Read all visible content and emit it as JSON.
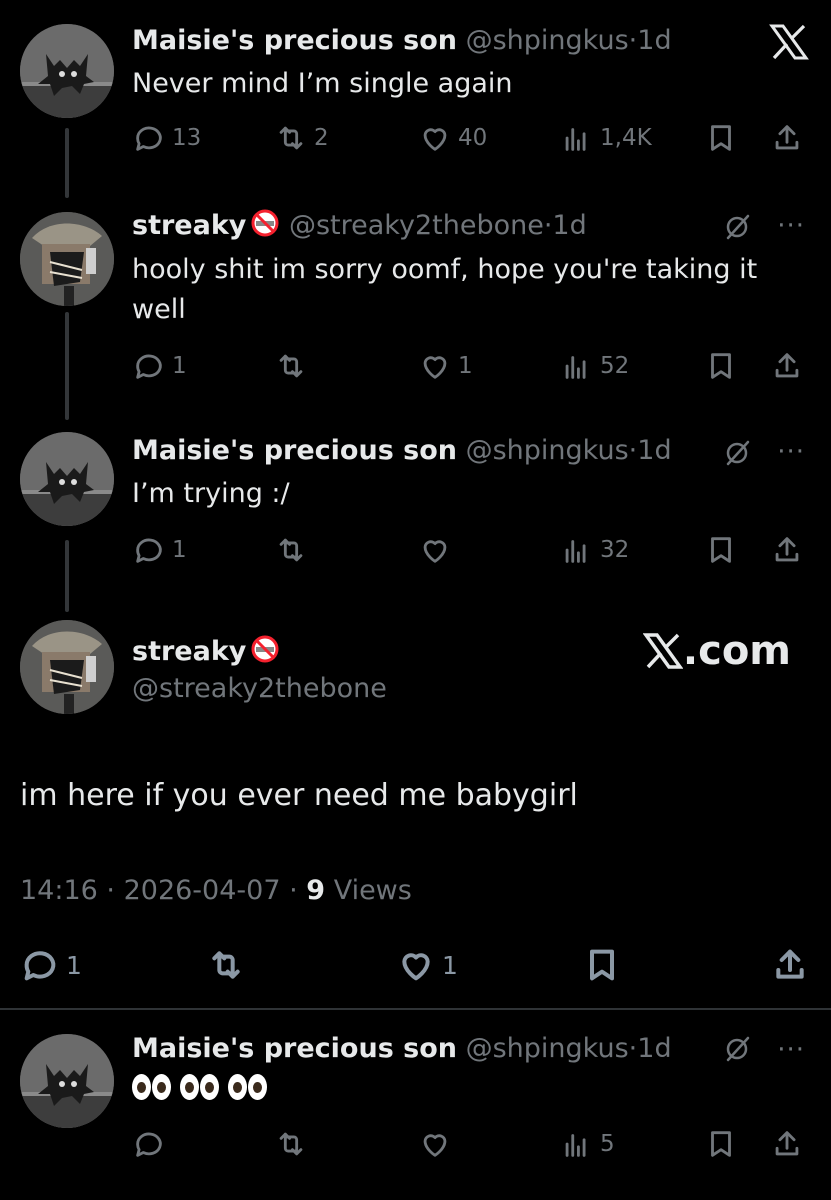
{
  "brand": {
    "watermark": ".com"
  },
  "posts": [
    {
      "name": "Maisie's precious son",
      "handle": "@shpingkus",
      "time": "1d",
      "text": "Never mind I’m single again",
      "stats": {
        "replies": "13",
        "reposts": "2",
        "likes": "40",
        "views": "1,4K"
      }
    },
    {
      "name": "streaky",
      "name_emoji": "no-smoking",
      "handle": "@streaky2thebone",
      "time": "1d",
      "text": "hooly shit im sorry oomf, hope you're taking it well",
      "stats": {
        "replies": "1",
        "reposts": "",
        "likes": "1",
        "views": "52"
      }
    },
    {
      "name": "Maisie's precious son",
      "handle": "@shpingkus",
      "time": "1d",
      "text": "I’m trying :/",
      "stats": {
        "replies": "1",
        "reposts": "",
        "likes": "",
        "views": "32"
      }
    }
  ],
  "main_post": {
    "name": "streaky",
    "name_emoji": "no-smoking",
    "handle": "@streaky2thebone",
    "text": "im here if you ever need me babygirl",
    "time": "14:16",
    "date": "2026-04-07",
    "views_count": "9",
    "views_label": "Views",
    "stats": {
      "replies": "1",
      "reposts": "",
      "likes": "1"
    }
  },
  "reply": {
    "name": "Maisie's precious son",
    "handle": "@shpingkus",
    "time": "1d",
    "text_emoji": "eyes eyes eyes",
    "stats": {
      "replies": "",
      "reposts": "",
      "likes": "",
      "views": "5"
    }
  },
  "separator": "·",
  "colors": {
    "background": "#000000",
    "text": "#e7e9ea",
    "muted": "#71767b",
    "line": "#333639"
  }
}
